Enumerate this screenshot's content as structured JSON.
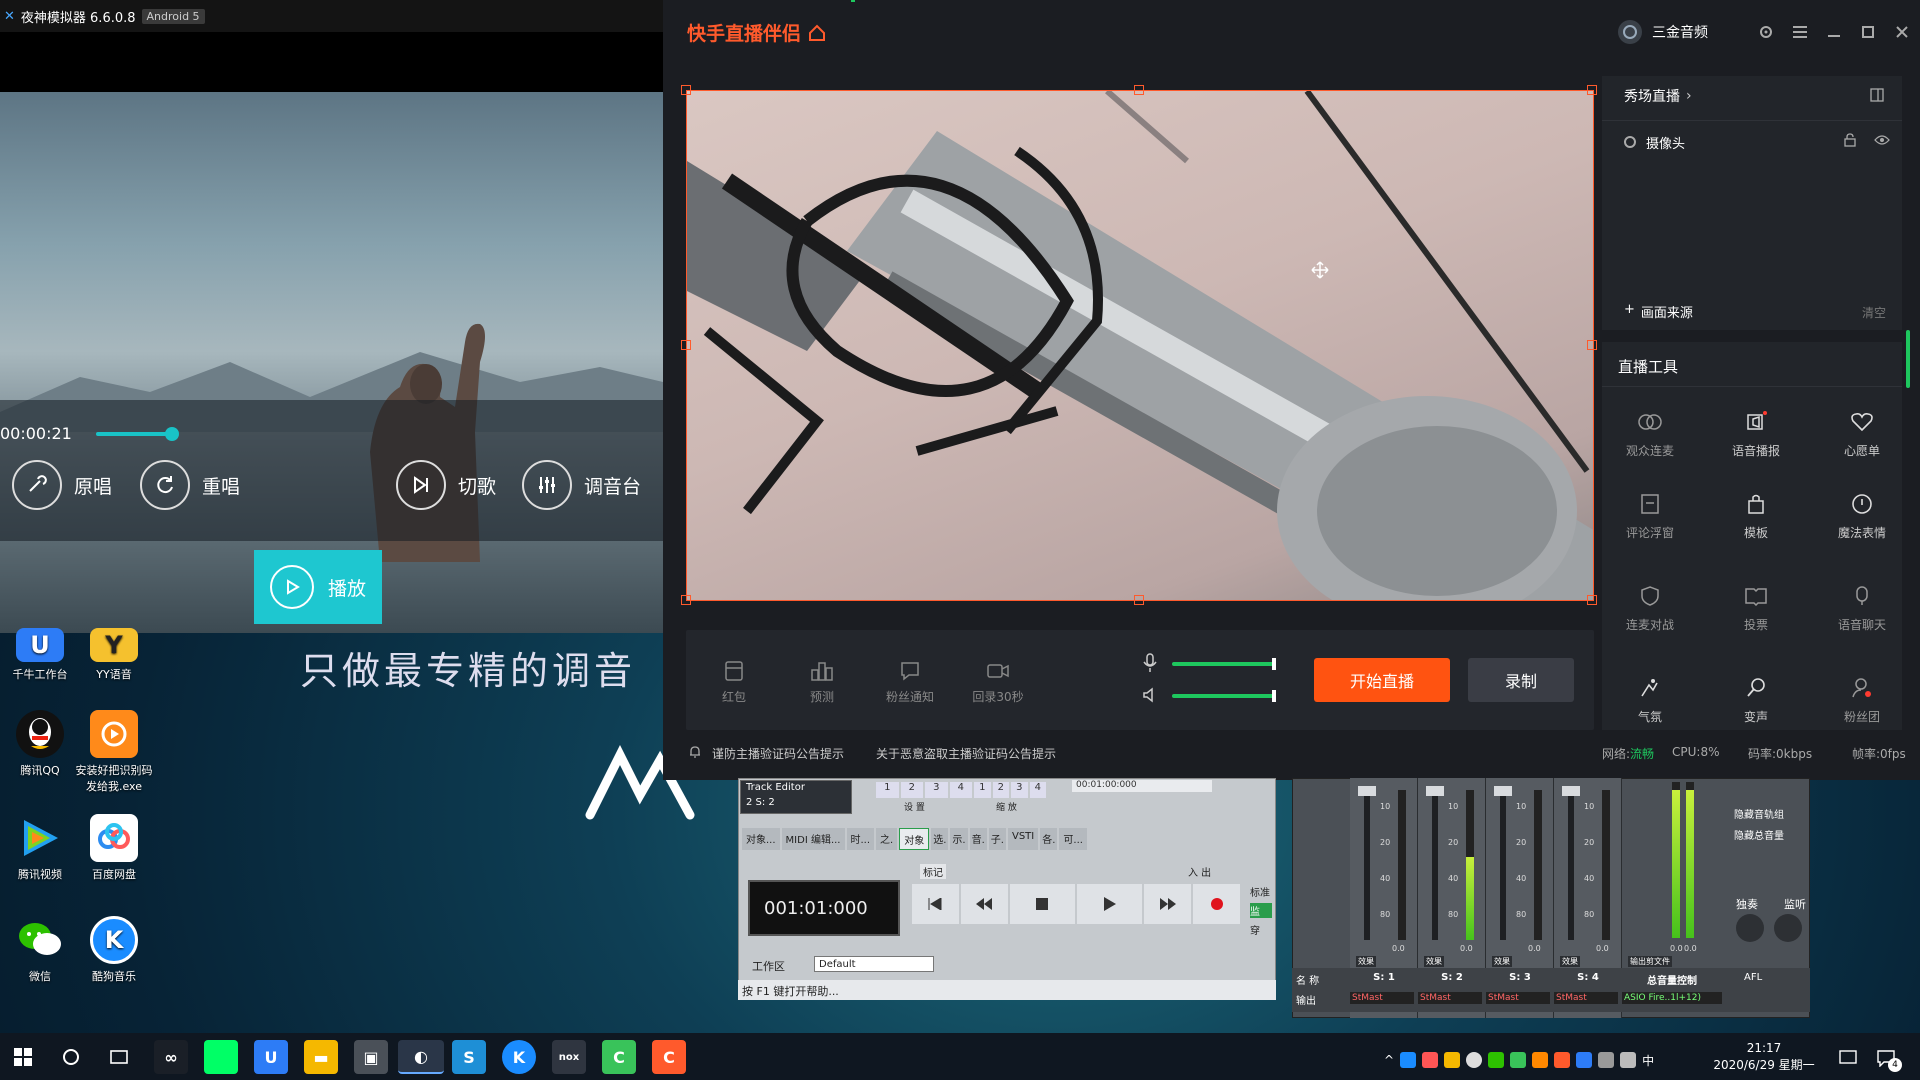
{
  "nox": {
    "title": "夜神模拟器 6.6.0.8",
    "badge": "Android 5"
  },
  "player": {
    "time": "00:00:21",
    "progress": 0.18,
    "buttons": [
      {
        "label": "原唱"
      },
      {
        "label": "重唱"
      },
      {
        "label": "播放"
      },
      {
        "label": "切歌"
      },
      {
        "label": "调音台"
      }
    ]
  },
  "desktop": {
    "slogan": "只做最专精的调音",
    "icons": [
      {
        "label": "千牛工作台",
        "icon": "qianniu-icon",
        "color": "#2d7cf6"
      },
      {
        "label": "YY语音",
        "icon": "yy-icon",
        "color": "#f5c12e"
      },
      {
        "label": "腾讯QQ",
        "icon": "qq-penguin-icon",
        "color": "#111111"
      },
      {
        "label": "安装好把识别码发给我.exe",
        "icon": "installer-icon",
        "color": "#ff8a1a"
      },
      {
        "label": "腾讯视频",
        "icon": "tencent-video-icon",
        "color": "#22a0f0"
      },
      {
        "label": "百度网盘",
        "icon": "baidu-netdisk-icon",
        "color": "#ffffff"
      },
      {
        "label": "微信",
        "icon": "wechat-icon",
        "color": "#2dc100"
      },
      {
        "label": "酷狗音乐",
        "icon": "kugou-icon",
        "color": "#1a8cff"
      }
    ]
  },
  "kuaishou": {
    "title": "快手直播伴侣",
    "user": "三金音频",
    "toolbar": [
      {
        "label": "红包",
        "icon": "red-packet-icon"
      },
      {
        "label": "预测",
        "icon": "prediction-icon"
      },
      {
        "label": "粉丝通知",
        "icon": "fan-notice-icon"
      },
      {
        "label": "回录30秒",
        "icon": "replay-30s-icon"
      }
    ],
    "mic_volume": 0.98,
    "speaker_volume": 0.98,
    "start_live": "开始直播",
    "record": "录制",
    "notices": [
      "谨防主播验证码公告提示",
      "关于恶意盗取主播验证码公告提示"
    ],
    "status": {
      "network_label": "网络:",
      "network_value": "流畅",
      "cpu": "CPU:8%",
      "bitrate": "码率:0kbps",
      "fps": "帧率:0fps"
    },
    "scene": {
      "title": "秀场直播",
      "source": "摄像头",
      "add_source": "画面来源",
      "clear": "清空"
    },
    "tools_title": "直播工具",
    "tools": [
      {
        "label": "观众连麦",
        "icon": "audience-link-icon"
      },
      {
        "label": "语音播报",
        "icon": "voice-broadcast-icon"
      },
      {
        "label": "心愿单",
        "icon": "heart-icon"
      },
      {
        "label": "评论浮窗",
        "icon": "comment-float-icon"
      },
      {
        "label": "模板",
        "icon": "template-icon"
      },
      {
        "label": "魔法表情",
        "icon": "magic-face-icon"
      },
      {
        "label": "连麦对战",
        "icon": "pk-battle-icon"
      },
      {
        "label": "投票",
        "icon": "vote-icon"
      },
      {
        "label": "语音聊天",
        "icon": "voice-chat-icon"
      },
      {
        "label": "气氛",
        "icon": "atmosphere-icon"
      },
      {
        "label": "变声",
        "icon": "voice-change-icon"
      },
      {
        "label": "粉丝团",
        "icon": "fan-club-icon"
      }
    ],
    "colors": {
      "accent": "#ff5a2c",
      "panel": "#1b1d22"
    }
  },
  "cubase": {
    "track_editor": "Track Editor",
    "track_sel": "2   S: 2",
    "settings_label": "设 置",
    "zoom_label": "缩 放",
    "timecode_small": "00:01:00:000",
    "tabs": [
      "对象...",
      "MIDI 编辑...",
      "时...",
      "之.",
      "对象",
      "选.",
      "示.",
      "音.",
      "子.",
      "VSTI",
      "各.",
      "可..."
    ],
    "markers_label": "标记",
    "in_out": "入 出",
    "big_time": "001:01:000",
    "std_label": "标准",
    "monitor_label": "监",
    "pass_label": "穿",
    "workspace_label": "工作区",
    "workspace_value": "Default",
    "help": "按 F1 键打开帮助..."
  },
  "mixer": {
    "channels": [
      "S: 1",
      "S: 2",
      "S: 3",
      "S: 4"
    ],
    "master_label": "总音量控制",
    "name_label": "名 称",
    "output_label": "输出",
    "output_values": [
      "StMast",
      "StMast",
      "StMast",
      "StMast",
      "ASIO Fire..1l+12)"
    ],
    "effect_label": "效果",
    "send_label": "输出剪文件",
    "hide_track": "隐藏音轨组",
    "hide_master": "隐藏总音量",
    "solo_label": "独奏",
    "listen_label": "监听",
    "afl_label": "AFL",
    "scale": [
      "10",
      "20",
      "40",
      "80"
    ],
    "meter_levels": [
      0.0,
      0.55,
      0.0,
      0.0,
      0.0,
      0.95
    ],
    "readouts": [
      "0.0",
      "0.0",
      "0.0",
      "0.0",
      "0.0",
      "0.0",
      "0.0",
      "0.0"
    ]
  },
  "taskbar": {
    "time": "21:17",
    "date": "2020/6/29 星期一",
    "ime": "中",
    "notification_count": "4"
  }
}
